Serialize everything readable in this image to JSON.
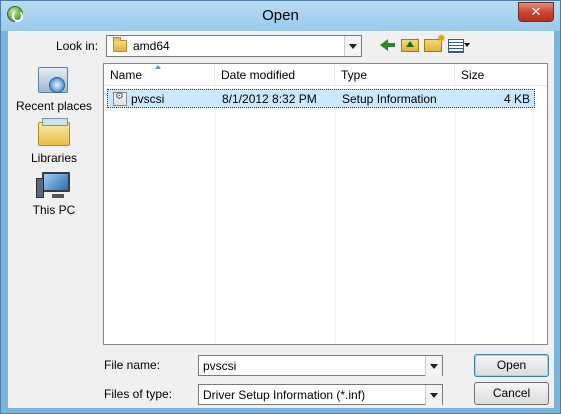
{
  "window": {
    "title": "Open",
    "close_glyph": "✕"
  },
  "toolbar": {
    "lookin_label": "Look in:",
    "lookin_value": "amd64",
    "icons": [
      "back-arrow-icon",
      "up-folder-icon",
      "new-folder-icon",
      "views-menu-icon"
    ]
  },
  "places": [
    {
      "label": "Recent places",
      "icon": "recent-places-icon"
    },
    {
      "label": "Libraries",
      "icon": "libraries-icon"
    },
    {
      "label": "This PC",
      "icon": "this-pc-icon"
    }
  ],
  "filelist": {
    "columns": [
      "Name",
      "Date modified",
      "Type",
      "Size"
    ],
    "rows": [
      {
        "name": "pvscsi",
        "date_modified": "8/1/2012 8:32 PM",
        "type": "Setup Information",
        "size": "4 KB",
        "selected": true
      }
    ]
  },
  "footer": {
    "filename_label": "File name:",
    "filename_value": "pvscsi",
    "filetype_label": "Files of type:",
    "filetype_value": "Driver Setup Information (*.inf)",
    "open_label": "Open",
    "cancel_label": "Cancel"
  },
  "colors": {
    "selection": "#cce8ff",
    "title_bar": "#9bcaed",
    "close_button": "#c8412a"
  }
}
